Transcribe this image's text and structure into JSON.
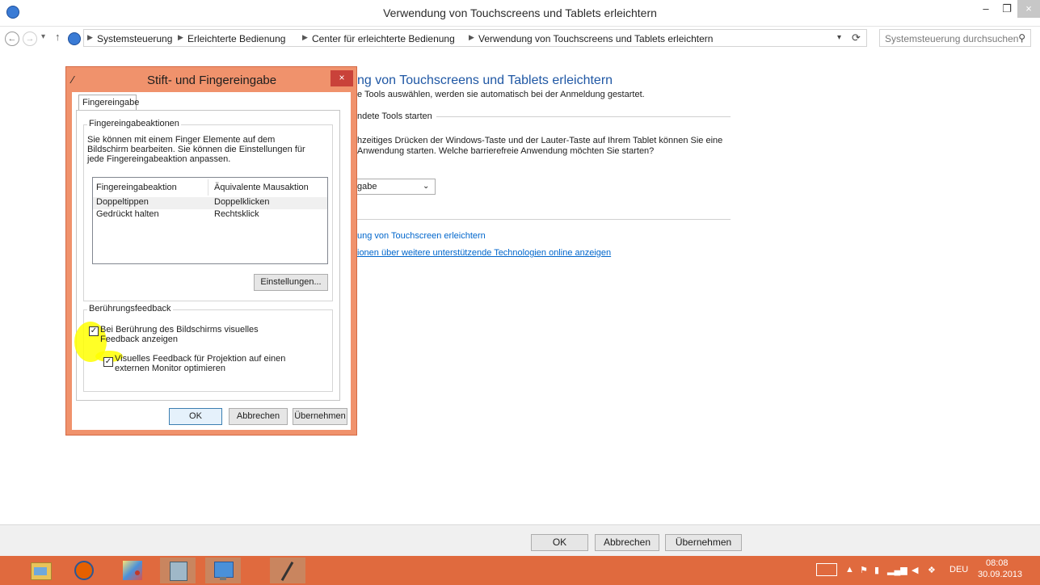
{
  "window": {
    "title": "Verwendung von Touchscreens und Tablets erleichtern",
    "min": "–",
    "max": "❐",
    "close": "×"
  },
  "nav": {
    "back": "←",
    "forward": "→",
    "dropdown": "▾",
    "up": "↑",
    "refresh": "⟳",
    "addr_dropdown": "▾"
  },
  "breadcrumb": [
    "Systemsteuerung",
    "Erleichterte Bedienung",
    "Center für erleichterte Bedienung",
    "Verwendung von Touchscreens und Tablets erleichtern"
  ],
  "search": {
    "placeholder": "Systemsteuerung durchsuchen"
  },
  "page": {
    "heading_partial": "ng von Touchscreens und Tablets erleichtern",
    "subtext_partial": "e Tools auswählen, werden sie automatisch bei der Anmeldung gestartet.",
    "group_partial": "ndete Tools starten",
    "body1_partial": "hzeitiges Drücken der Windows-Taste und der Lauter-Taste auf Ihrem Tablet können Sie eine",
    "body2_partial": "Anwendung starten. Welche barrierefreie Anwendung möchten Sie starten?",
    "select_partial": "gabe",
    "link1_partial": "ung von Touchscreen erleichtern",
    "link2_partial": "ionen über weitere unterstützende Technologien online anzeigen"
  },
  "dialog": {
    "title": "Stift- und Fingereingabe",
    "close": "×",
    "pen": "∕",
    "tab": "Fingereingabe",
    "actions_legend": "Fingereingabeaktionen",
    "actions_desc": "Sie können mit einem Finger Elemente auf dem Bildschirm bearbeiten. Sie können die Einstellungen für jede Fingereingabeaktion anpassen.",
    "list_headers": [
      "Fingereingabeaktion",
      "Äquivalente Mausaktion"
    ],
    "list_rows": [
      [
        "Doppeltippen",
        "Doppelklicken"
      ],
      [
        "Gedrückt halten",
        "Rechtsklick"
      ]
    ],
    "settings_button": "Einstellungen...",
    "feedback_legend": "Berührungsfeedback",
    "check1": "Bei Berührung des Bildschirms visuelles Feedback anzeigen",
    "check2": "Visuelles Feedback für Projektion auf einen externen Monitor optimieren",
    "check_mark": "✓",
    "ok": "OK",
    "cancel": "Abbrechen",
    "apply": "Übernehmen"
  },
  "bottom": {
    "ok": "OK",
    "cancel": "Abbrechen",
    "apply": "Übernehmen"
  },
  "taskbar": {
    "lang": "DEU",
    "time": "08:08",
    "date": "30.09.2013",
    "tray_up": "▲"
  },
  "colors": {
    "taskbar": "#e06a3e",
    "dialog_frame": "#f0926c",
    "link": "#0066cc",
    "heading": "#1f57a4",
    "highlight": "#ffff00"
  }
}
